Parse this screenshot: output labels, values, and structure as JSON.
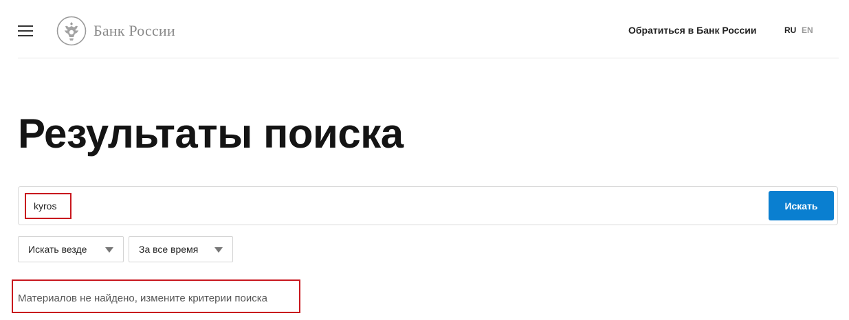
{
  "header": {
    "logo_text": "Банк России",
    "contact_link": "Обратиться в Банк России",
    "languages": [
      {
        "code": "RU",
        "active": true
      },
      {
        "code": "EN",
        "active": false
      }
    ]
  },
  "main": {
    "title": "Результаты поиска",
    "search": {
      "value": "kyros",
      "button_label": "Искать"
    },
    "filters": [
      {
        "label": "Искать везде"
      },
      {
        "label": "За все время"
      }
    ],
    "no_results_message": "Материалов не найдено, измените критерии поиска"
  },
  "colors": {
    "accent": "#0a7fd0",
    "highlight": "#c8161d"
  },
  "icons": [
    "menu-icon",
    "bank-emblem-icon",
    "chevron-down-icon"
  ]
}
